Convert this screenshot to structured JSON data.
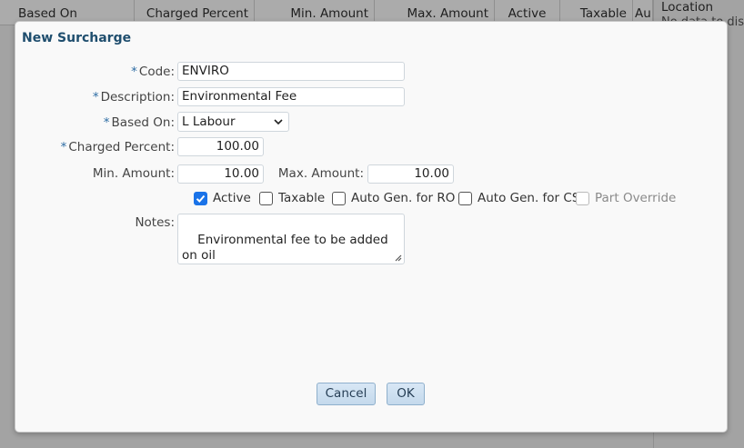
{
  "background": {
    "columns": [
      {
        "label": "Based On"
      },
      {
        "label": "Charged Percent"
      },
      {
        "label": "Min. Amount"
      },
      {
        "label": "Max. Amount"
      },
      {
        "label": "Active"
      },
      {
        "label": "Taxable"
      },
      {
        "label": "Au"
      }
    ],
    "location_header": "Location",
    "location_subtext": "No data to display"
  },
  "dialog": {
    "title": "New Surcharge",
    "required_marker": "*",
    "fields": {
      "code": {
        "label": "Code:",
        "value": "ENVIRO"
      },
      "description": {
        "label": "Description:",
        "value": "Environmental Fee"
      },
      "based_on": {
        "label": "Based On:",
        "value": "L Labour"
      },
      "charged_percent": {
        "label": "Charged Percent:",
        "value": "100.00"
      },
      "min_amount": {
        "label": "Min. Amount:",
        "value": "10.00"
      },
      "max_amount": {
        "label": "Max. Amount:",
        "value": "10.00"
      },
      "notes": {
        "label": "Notes:",
        "value": "Environmental fee to be added on oil\nchanges"
      }
    },
    "checkboxes": [
      {
        "label": "Active",
        "checked": true,
        "disabled": false
      },
      {
        "label": "Taxable",
        "checked": false,
        "disabled": false
      },
      {
        "label": "Auto Gen. for RO",
        "checked": false,
        "disabled": false
      },
      {
        "label": "Auto Gen. for CS",
        "checked": false,
        "disabled": false
      },
      {
        "label": "Part Override",
        "checked": false,
        "disabled": true
      }
    ],
    "buttons": {
      "cancel": "Cancel",
      "ok": "OK"
    }
  },
  "colors": {
    "title": "#1f4e6e",
    "required": "#2e6da4",
    "checkbox_checked": "#1a73e8",
    "button_bg": "#cfe0f0"
  },
  "icons": {
    "select": "chevron-down-icon",
    "check": "check-icon",
    "resize": "resize-grip-icon"
  }
}
